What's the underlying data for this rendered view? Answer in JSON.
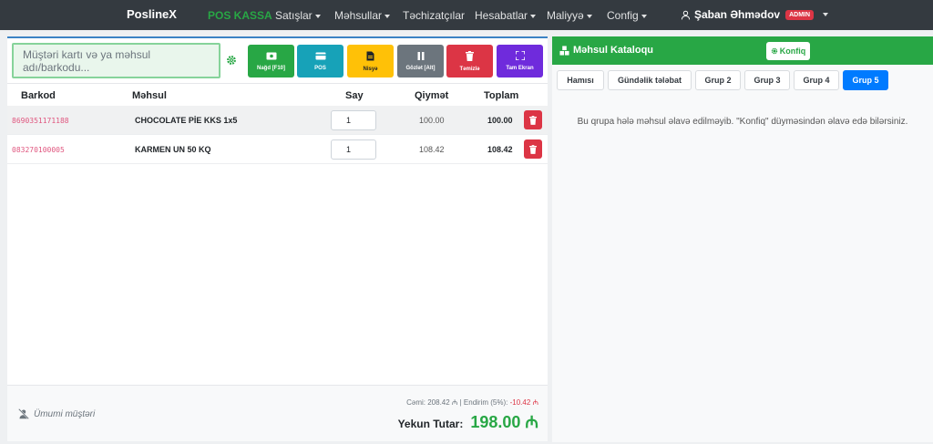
{
  "nav": {
    "brand": "PoslineX",
    "items": [
      {
        "label": "POS KASSA",
        "active": true,
        "dropdown": false
      },
      {
        "label": "Satışlar",
        "active": false,
        "dropdown": true
      },
      {
        "label": "Məhsullar",
        "active": false,
        "dropdown": true
      },
      {
        "label": "Təchizatçılar",
        "active": false,
        "dropdown": false
      },
      {
        "label": "Hesabatlar",
        "active": false,
        "dropdown": true
      },
      {
        "label": "Maliyyə",
        "active": false,
        "dropdown": true
      },
      {
        "label": "Config",
        "active": false,
        "dropdown": true
      }
    ],
    "user_name": "Şaban Əhmədov",
    "user_role": "ADMIN"
  },
  "pos": {
    "search_placeholder": "Müştəri kartı və ya məhsul adı/barkodu...",
    "actions": [
      {
        "label": "Nağd [F10]",
        "icon": "cash-icon",
        "color": "#28a745"
      },
      {
        "label": "POS",
        "icon": "card-icon",
        "color": "#17a2b8"
      },
      {
        "label": "Nisyə",
        "icon": "invoice-icon",
        "color": "#ffc107"
      },
      {
        "label": "Gözlət [Alt]",
        "icon": "pause-icon",
        "color": "#6c757d"
      },
      {
        "label": "Təmizlə",
        "icon": "trash-icon",
        "color": "#dc3545"
      },
      {
        "label": "Tam Ekran",
        "icon": "fullscreen-icon",
        "color": "#6f2bdc"
      }
    ],
    "columns": {
      "barcode": "Barkod",
      "product": "Məhsul",
      "qty": "Say",
      "price": "Qiymət",
      "total": "Toplam"
    },
    "rows": [
      {
        "barcode": "8690351171188",
        "product": "CHOCOLATE PİE KKS 1x5",
        "qty": "1",
        "price": "100.00",
        "total": "100.00"
      },
      {
        "barcode": "083270100005",
        "product": "KARMEN UN 50 KQ",
        "qty": "1",
        "price": "108.42",
        "total": "108.42"
      }
    ],
    "customer": "Ümumi müştəri",
    "sum_label": "Cəmi: 208.42 ₼ | Endirim (5%):",
    "discount": "-10.42 ₼",
    "final_label": "Yekun Tutar:",
    "final_value": "198.00 ₼"
  },
  "catalog": {
    "title": "Məhsul Kataloqu",
    "konfig_label": "Konfiq",
    "tabs": [
      {
        "label": "Hamısı",
        "active": false
      },
      {
        "label": "Gündəlik tələbat",
        "active": false
      },
      {
        "label": "Grup 2",
        "active": false
      },
      {
        "label": "Grup 3",
        "active": false
      },
      {
        "label": "Grup 4",
        "active": false
      },
      {
        "label": "Grup 5",
        "active": true
      }
    ],
    "empty_message": "Bu qrupa hələ məhsul əlavə edilməyib. \"Konfiq\" düyməsindən əlavə edə bilərsiniz."
  },
  "colors": {
    "navbar": "#343a40",
    "accent_green": "#28a745",
    "accent_blue": "#007bff",
    "danger": "#dc3545"
  }
}
